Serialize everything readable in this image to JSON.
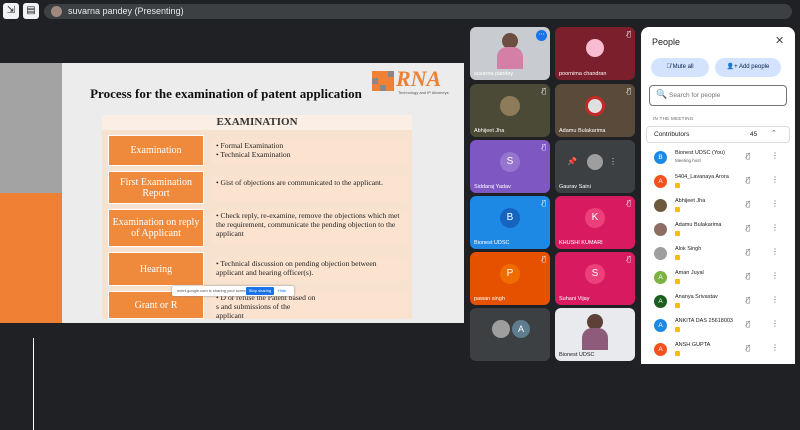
{
  "top_bar": {
    "presenting_label": "suvarna pandey (Presenting)"
  },
  "slide": {
    "title": "Process for the examination of patent application",
    "logo_text": "RNA",
    "logo_sub": "Technology and IP Attorneys",
    "section_header": "EXAMINATION",
    "steps": [
      {
        "label": "Examination",
        "desc": "• Formal Examination\n• Technical Examination"
      },
      {
        "label": "First Examination Report",
        "desc": "• Gist of objections are communicated to the applicant."
      },
      {
        "label": "Examination on reply of Applicant",
        "desc": "• Check reply, re-examine, remove the objections which met the requirement, communicate the pending objection to the applicant"
      },
      {
        "label": "Hearing",
        "desc": "• Technical discussion on pending objection between applicant and hearing officer(s)."
      },
      {
        "label": "Grant or R",
        "desc": "• D          or refuse the Patent based on\n          s and submissions of the\n  applicant"
      }
    ],
    "share_bar": {
      "text": "meet.google.com is sharing your screen.",
      "stop_label": "Stop sharing",
      "hide_label": "Hide"
    }
  },
  "tiles": [
    {
      "name": "suvarna pandey",
      "avatar": "",
      "color": "#c8ccd0"
    },
    {
      "name": "poornima chandran",
      "avatar": "",
      "color": "#7a1f2b"
    },
    {
      "name": "Abhijeet Jha",
      "avatar": "",
      "color": "#4a4a36"
    },
    {
      "name": "Adamu Bulakarima",
      "avatar": "",
      "color": "#5a4a3a"
    },
    {
      "name": "Siddaraj Yadav",
      "avatar": "S",
      "color": "#7e57c2"
    },
    {
      "name": "Gaurav Saini",
      "avatar": "",
      "color": "#3c4043"
    },
    {
      "name": "Bionest UDSC",
      "avatar": "B",
      "color": "#1e88e5"
    },
    {
      "name": "KHUSHI KUMARI",
      "avatar": "K",
      "color": "#d81b60"
    },
    {
      "name": "pawan singh",
      "avatar": "P",
      "color": "#e65100"
    },
    {
      "name": "Suhani Vijay",
      "avatar": "S",
      "color": "#d81b60"
    },
    {
      "name": "",
      "avatar": "A",
      "color": "#5f7d8e"
    },
    {
      "name": "Bionest UDSC",
      "avatar": "",
      "color": "#e8eaed"
    }
  ],
  "people_panel": {
    "title": "People",
    "mute_all": "Mute all",
    "add_people": "Add people",
    "search_placeholder": "Search for people",
    "section_label": "IN THE MEETING",
    "contributors_label": "Contributors",
    "contributors_count": "45",
    "people": [
      {
        "name": "Bionest UDSC (You)",
        "sub": "Meeting host",
        "avatar": "B",
        "color": "#1e88e5"
      },
      {
        "name": "5404_Lavanaya Arora",
        "sub": "",
        "avatar": "A",
        "color": "#f4511e"
      },
      {
        "name": "Abhijeet Jha",
        "sub": "",
        "avatar": "",
        "color": "#6d5a3e"
      },
      {
        "name": "Adamu Bulakarima",
        "sub": "",
        "avatar": "",
        "color": "#8d6e63"
      },
      {
        "name": "Alok Singh",
        "sub": "",
        "avatar": "",
        "color": "#9e9e9e"
      },
      {
        "name": "Aman Juyal",
        "sub": "",
        "avatar": "A",
        "color": "#7cb342"
      },
      {
        "name": "Ananya Srivastav",
        "sub": "",
        "avatar": "A",
        "color": "#1b5e20"
      },
      {
        "name": "ANKITA DAS 25618003",
        "sub": "",
        "avatar": "A",
        "color": "#1e88e5"
      },
      {
        "name": "ANSH GUPTA",
        "sub": "",
        "avatar": "A",
        "color": "#f4511e"
      }
    ]
  }
}
